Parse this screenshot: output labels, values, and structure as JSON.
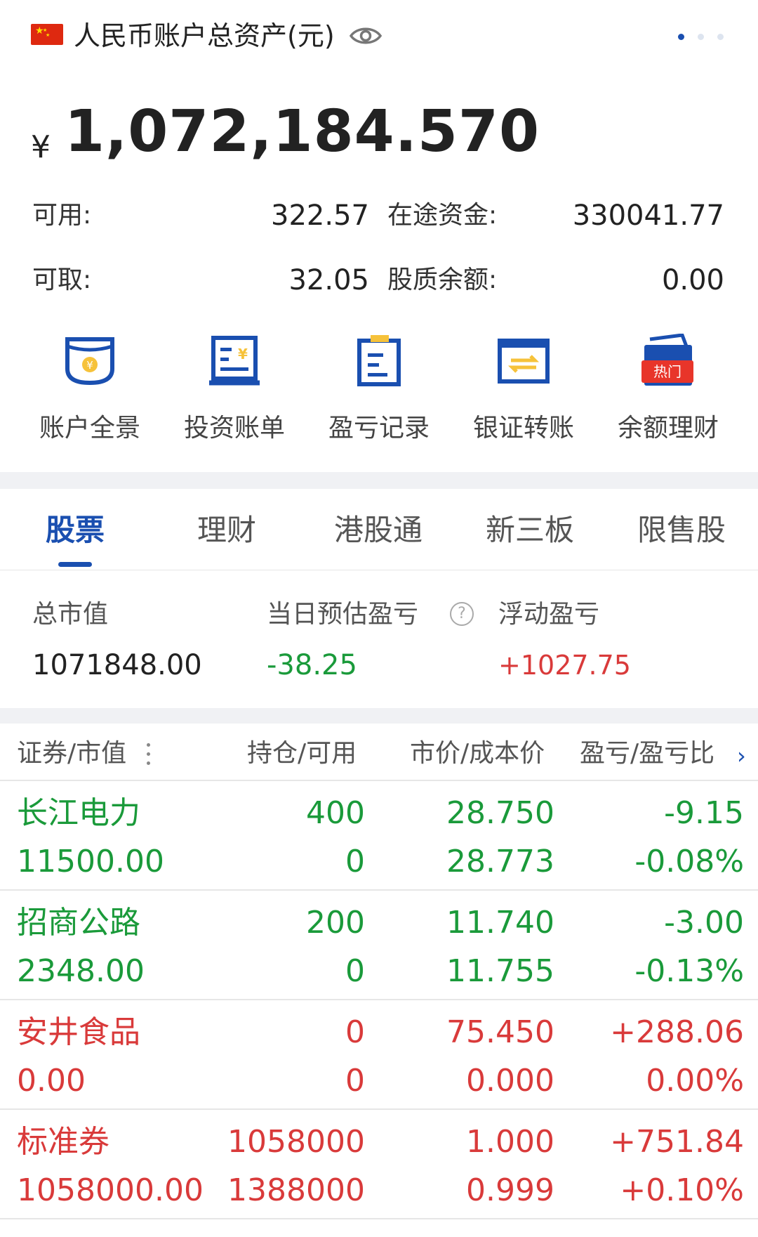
{
  "header": {
    "title": "人民币账户总资产(元)",
    "flag_icon": "china-flag-icon",
    "eye_icon": "eye-icon",
    "page_dots": 3,
    "active_dot": 0
  },
  "assets": {
    "currency_symbol": "¥",
    "total": "1,072,184.570",
    "available_label": "可用:",
    "available_value": "322.57",
    "in_transit_label": "在途资金:",
    "in_transit_value": "330041.77",
    "withdrawable_label": "可取:",
    "withdrawable_value": "32.05",
    "pledge_label": "股质余额:",
    "pledge_value": "0.00"
  },
  "actions": [
    {
      "label": "账户全景",
      "icon": "account-overview-icon"
    },
    {
      "label": "投资账单",
      "icon": "investment-bill-icon"
    },
    {
      "label": "盈亏记录",
      "icon": "profit-loss-record-icon"
    },
    {
      "label": "银证转账",
      "icon": "bank-transfer-icon"
    },
    {
      "label": "余额理财",
      "icon": "balance-finance-icon",
      "badge": "热门"
    }
  ],
  "tabs": [
    {
      "label": "股票",
      "active": true
    },
    {
      "label": "理财",
      "active": false
    },
    {
      "label": "港股通",
      "active": false
    },
    {
      "label": "新三板",
      "active": false
    },
    {
      "label": "限售股",
      "active": false
    }
  ],
  "summary": {
    "market_value_label": "总市值",
    "market_value": "1071848.00",
    "daily_pl_label": "当日预估盈亏",
    "daily_pl": "-38.25",
    "floating_pl_label": "浮动盈亏",
    "floating_pl": "+1027.75",
    "help_icon": "?"
  },
  "table": {
    "headers": [
      "证券/市值",
      "持仓/可用",
      "市价/成本价",
      "盈亏/盈亏比"
    ],
    "rows": [
      {
        "name": "长江电力",
        "value": "11500.00",
        "position": "400",
        "available": "0",
        "price": "28.750",
        "cost": "28.773",
        "pl": "-9.15",
        "pl_ratio": "-0.08%",
        "color": "green"
      },
      {
        "name": "招商公路",
        "value": "2348.00",
        "position": "200",
        "available": "0",
        "price": "11.740",
        "cost": "11.755",
        "pl": "-3.00",
        "pl_ratio": "-0.13%",
        "color": "green"
      },
      {
        "name": "安井食品",
        "value": "0.00",
        "position": "0",
        "available": "0",
        "price": "75.450",
        "cost": "0.000",
        "pl": "+288.06",
        "pl_ratio": "0.00%",
        "color": "red"
      },
      {
        "name": "标准券",
        "value": "1058000.00",
        "position": "1058000",
        "available": "1388000",
        "price": "1.000",
        "cost": "0.999",
        "pl": "+751.84",
        "pl_ratio": "+0.10%",
        "color": "red"
      }
    ]
  },
  "colors": {
    "accent": "#1a4fb0",
    "gain": "#d93a3a",
    "loss": "#1a9a3a",
    "icon_yellow": "#f6c23a",
    "hot_badge": "#e8352a"
  }
}
